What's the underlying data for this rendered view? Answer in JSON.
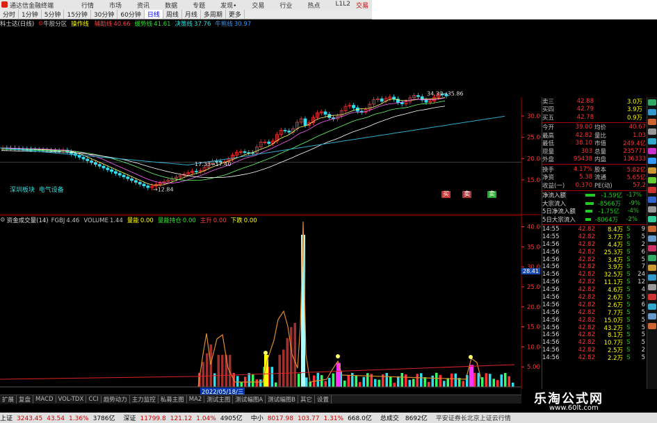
{
  "window": {
    "title": "通达信金融终端",
    "menu": [
      "行情",
      "市场",
      "资讯",
      "数据",
      "专题",
      "发现",
      "交易",
      "行业",
      "热点",
      "L1L2"
    ],
    "trade_btn": "交易"
  },
  "periods": [
    "分时",
    "1分钟",
    "5分钟",
    "15分钟",
    "30分钟",
    "60分钟",
    "日线",
    "周线",
    "月线",
    "多周期",
    "更多"
  ],
  "active_period": "日线",
  "indicator_line": {
    "name": "科士达(日线)",
    "mode": "牛股分区",
    "items": [
      {
        "label": "操作线",
        "value": "",
        "color": "#ffff00"
      },
      {
        "label": "辅助线",
        "value": "40.66",
        "color": "#ff4040"
      },
      {
        "label": "缓势线",
        "value": "41.61",
        "color": "#30e030"
      },
      {
        "label": "决策线",
        "value": "37.76",
        "color": "#30e0e0"
      },
      {
        "label": "牛熊线",
        "value": "30.97",
        "color": "#3399ff"
      }
    ]
  },
  "kchart_labels": {
    "high": "34.39→35.86",
    "low1": "17.33→17.40",
    "low2": "→12.84",
    "tag": "深圳板块",
    "tag2": "电气设备",
    "buy": "买",
    "sell1": "卖",
    "sell2": "卖"
  },
  "price_axis": [
    "30.00",
    "25.00",
    "20.00",
    "15.00"
  ],
  "vol_axis": [
    "40.00",
    "35.00",
    "30.00",
    "25.00",
    "20.00",
    "15.00",
    "10.00",
    "5.00"
  ],
  "indicator_line2": {
    "name": "资金成交量(14)",
    "items": [
      {
        "label": "FGBJ",
        "value": "4.46",
        "color": "#c0c0c0"
      },
      {
        "label": "VOLUME",
        "value": "1.44",
        "color": "#c0c0c0"
      },
      {
        "label": "量能",
        "value": "0.00",
        "color": "#ffff00"
      },
      {
        "label": "量能持仓",
        "value": "0.00",
        "color": "#30e030"
      },
      {
        "label": "主升",
        "value": "0.00",
        "color": "#ff4040"
      },
      {
        "label": "下跌",
        "value": "0.00",
        "color": "#ffff00"
      }
    ]
  },
  "date_box": "2022/05/18/三",
  "price_tag": "28.41",
  "tabs": [
    "扩展",
    "复盘",
    "MACD",
    "VOL-TDX",
    "CCI",
    "趋势动力",
    "主力监控",
    "私募主图",
    "MA2",
    "测试主图",
    "测试幅图A",
    "测试幅图B",
    "其它",
    "设置"
  ],
  "statusbar": [
    {
      "label": "上证",
      "val": "3243.45",
      "chg": "43.54",
      "pct": "1.36%",
      "amt": "3786亿"
    },
    {
      "label": "深证",
      "val": "11799.8",
      "chg": "121.12",
      "pct": "1.04%",
      "amt": "4905亿"
    },
    {
      "label": "中小",
      "val": "8017.98",
      "chg": "103.77",
      "pct": "1.31%",
      "amt": "668.0亿"
    }
  ],
  "status_total": {
    "label": "总成交",
    "amt": "8692亿"
  },
  "status_right": "平安证券长北京上证云行情",
  "quote": {
    "asks": [
      {
        "l": "卖三",
        "p": "42.88",
        "v": "3.0万"
      },
      {
        "l": "买四",
        "p": "42.79",
        "v": "3.9万"
      },
      {
        "l": "买五",
        "p": "42.78",
        "v": "0.9万"
      }
    ],
    "stats": [
      {
        "l1": "今开",
        "v1": "39.00",
        "l2": "均价",
        "v2": "40.67"
      },
      {
        "l1": "最高",
        "v1": "42.82",
        "l2": "量比",
        "v2": "1.03"
      },
      {
        "l1": "最低",
        "v1": "38.10",
        "l2": "市值",
        "v2": "249.4亿"
      },
      {
        "l1": "现量",
        "v1": "303",
        "l2": "总量",
        "v2": "235771"
      },
      {
        "l1": "外盘",
        "v1": "95438",
        "l2": "内盘",
        "v2": "136333"
      }
    ],
    "stats2": [
      {
        "l1": "换手",
        "v1": "4.17%",
        "l2": "股本",
        "v2": "5.82亿"
      },
      {
        "l1": "净资",
        "v1": "5.38",
        "l2": "流通",
        "v2": "5.65亿"
      },
      {
        "l1": "收益(一)",
        "v1": "0.370",
        "l2": "PE(动)",
        "v2": "57.2"
      }
    ],
    "flows": [
      {
        "l": "净流入额",
        "v": "-1.59亿",
        "p": "-17%"
      },
      {
        "l": "大宗流入",
        "v": "-8566万",
        "p": "-9%"
      },
      {
        "l": "5日净流入额",
        "v": "-1.75亿",
        "p": "-4%"
      },
      {
        "l": "5日大宗流入",
        "v": "-8064万",
        "p": "-2%"
      }
    ],
    "ticks": [
      {
        "t": "14:55",
        "p": "42.82",
        "v": "8.4万",
        "s": "S",
        "n": "9"
      },
      {
        "t": "14:55",
        "p": "42.82",
        "v": "3.7万",
        "s": "S",
        "n": "5"
      },
      {
        "t": "14:56",
        "p": "42.82",
        "v": "4.4万",
        "s": "S",
        "n": "2"
      },
      {
        "t": "14:56",
        "p": "42.82",
        "v": "25.3万",
        "s": "S",
        "n": "6"
      },
      {
        "t": "14:56",
        "p": "42.82",
        "v": "3.4万",
        "s": "S",
        "n": "5"
      },
      {
        "t": "14:56",
        "p": "42.82",
        "v": "3.9万",
        "s": "S",
        "n": "7"
      },
      {
        "t": "14:56",
        "p": "42.82",
        "v": "32.5万",
        "s": "S",
        "n": "24"
      },
      {
        "t": "14:56",
        "p": "42.82",
        "v": "11.1万",
        "s": "S",
        "n": "12"
      },
      {
        "t": "14:56",
        "p": "42.82",
        "v": "4.6万",
        "s": "S",
        "n": "4"
      },
      {
        "t": "14:56",
        "p": "42.82",
        "v": "2.6万",
        "s": "S",
        "n": "5"
      },
      {
        "t": "14:56",
        "p": "42.82",
        "v": "2.6万",
        "s": "S",
        "n": "6"
      },
      {
        "t": "14:56",
        "p": "42.82",
        "v": "7.7万",
        "s": "S",
        "n": "5"
      },
      {
        "t": "14:56",
        "p": "42.82",
        "v": "15.0万",
        "s": "S",
        "n": "5"
      },
      {
        "t": "14:56",
        "p": "42.82",
        "v": "43.2万",
        "s": "S",
        "n": "5"
      },
      {
        "t": "14:56",
        "p": "42.82",
        "v": "8.1万",
        "s": "S",
        "n": "5"
      },
      {
        "t": "14:56",
        "p": "42.82",
        "v": "10.7万",
        "s": "S",
        "n": "5"
      },
      {
        "t": "14:56",
        "p": "42.82",
        "v": "2.5万",
        "s": "S",
        "n": "2"
      },
      {
        "t": "14:56",
        "p": "42.82",
        "v": "2.2万",
        "s": "S",
        "n": "5"
      }
    ]
  },
  "watermark": {
    "cn": "乐淘公式网",
    "url": "www.60lt.com"
  },
  "colors": {
    "up": "#ff3333",
    "down": "#33ddee",
    "bg": "#000000",
    "accent": "#0033aa"
  }
}
